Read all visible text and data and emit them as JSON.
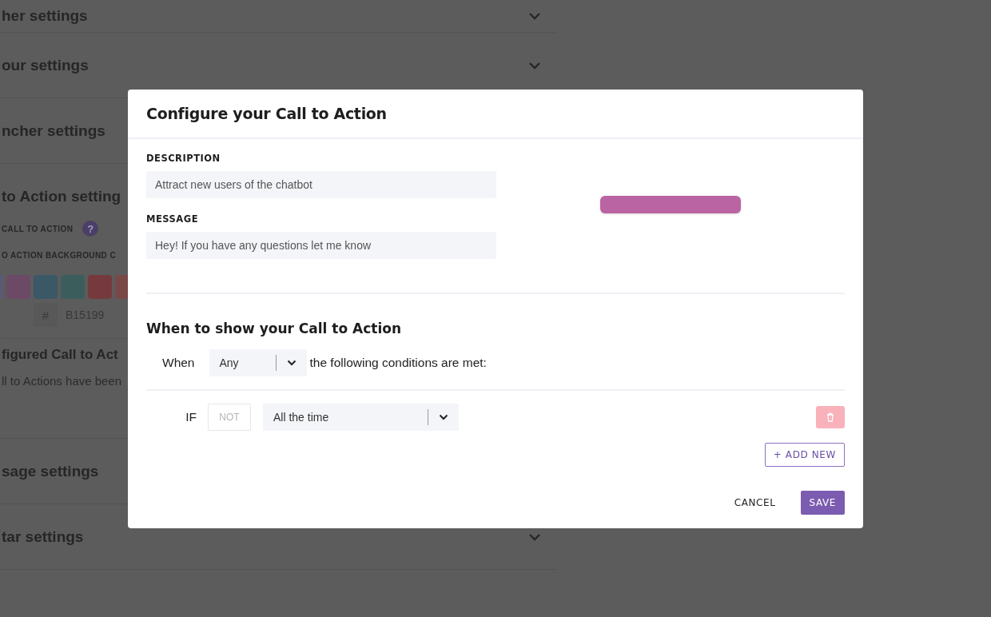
{
  "background": {
    "sections": [
      {
        "title": "her settings",
        "chevron": true
      },
      {
        "title": "our settings",
        "chevron": true
      },
      {
        "title": "ncher settings"
      },
      {
        "title": "to Action setting",
        "expanded": true,
        "body": {
          "toggle_label": "CALL TO ACTION",
          "help": "?",
          "color_label": "O ACTION BACKGROUND C",
          "swatches": [
            {
              "color": "#5e5878"
            },
            {
              "color": "#6c4a66"
            },
            {
              "color": "#3b5866"
            },
            {
              "color": "#3b5e5c"
            },
            {
              "color": "#763a3e"
            },
            {
              "color": "#7b4848"
            }
          ],
          "hash": "#",
          "hex": "B15199",
          "list_title": "figured Call to Act",
          "list_text": "ll to Actions have been"
        }
      },
      {
        "title": "sage settings"
      },
      {
        "title": "tar settings",
        "chevron": true
      }
    ]
  },
  "modal": {
    "title": "Configure your Call to Action",
    "fields": [
      {
        "label": "DESCRIPTION",
        "value": "Attract new users of the chatbot"
      },
      {
        "label": "MESSAGE",
        "value": "Hey! If you have any questions let me know"
      }
    ],
    "conditions": {
      "title": "When to show your Call to Action",
      "prefix": "When",
      "match": "Any",
      "suffix": "the following conditions are met:",
      "rules": [
        {
          "prefix": "IF",
          "negate": {
            "label": "NOT",
            "selected": false
          },
          "value": "All the time"
        }
      ],
      "add_button": "+ ADD NEW"
    },
    "actions": [
      {
        "label": "CANCEL",
        "kind": "text"
      },
      {
        "label": "SAVE",
        "kind": "primary"
      }
    ]
  }
}
